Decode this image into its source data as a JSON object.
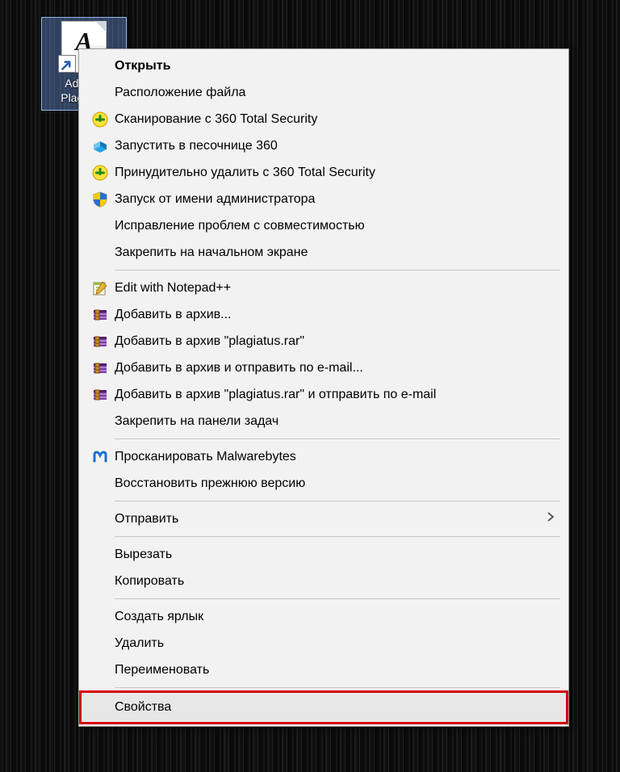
{
  "desktop": {
    "shortcut": {
      "label_line1": "Advego",
      "label_line2": "Plagiatus",
      "glyph": "A"
    }
  },
  "menu": {
    "items": [
      {
        "id": "open",
        "label": "Открыть",
        "icon": null,
        "bold": true
      },
      {
        "id": "file-location",
        "label": "Расположение файла",
        "icon": null
      },
      {
        "id": "scan-360",
        "label": "Сканирование с 360 Total Security",
        "icon": "scan360"
      },
      {
        "id": "sandbox-360",
        "label": "Запустить в песочнице 360",
        "icon": "sandbox"
      },
      {
        "id": "force-delete-360",
        "label": "Принудительно удалить с  360 Total Security",
        "icon": "scan360"
      },
      {
        "id": "run-as-admin",
        "label": "Запуск от имени администратора",
        "icon": "shield"
      },
      {
        "id": "compat-fix",
        "label": "Исправление проблем с совместимостью",
        "icon": null
      },
      {
        "id": "pin-start",
        "label": "Закрепить на начальном экране",
        "icon": null
      },
      {
        "sep": true
      },
      {
        "id": "edit-npp",
        "label": "Edit with Notepad++",
        "icon": "notepadpp"
      },
      {
        "id": "rar-add",
        "label": "Добавить в архив...",
        "icon": "winrar"
      },
      {
        "id": "rar-add-named",
        "label": "Добавить в архив \"plagiatus.rar\"",
        "icon": "winrar"
      },
      {
        "id": "rar-add-email",
        "label": "Добавить в архив и отправить по e-mail...",
        "icon": "winrar"
      },
      {
        "id": "rar-add-named-email",
        "label": "Добавить в архив \"plagiatus.rar\" и отправить по e-mail",
        "icon": "winrar"
      },
      {
        "id": "pin-taskbar",
        "label": "Закрепить на панели задач",
        "icon": null
      },
      {
        "sep": true
      },
      {
        "id": "scan-mwb",
        "label": "Просканировать Malwarebytes",
        "icon": "malwarebytes"
      },
      {
        "id": "restore-prev",
        "label": "Восстановить прежнюю версию",
        "icon": null
      },
      {
        "sep": true
      },
      {
        "id": "send-to",
        "label": "Отправить",
        "icon": null,
        "submenu": true
      },
      {
        "sep": true
      },
      {
        "id": "cut",
        "label": "Вырезать",
        "icon": null
      },
      {
        "id": "copy",
        "label": "Копировать",
        "icon": null
      },
      {
        "sep": true
      },
      {
        "id": "create-shortcut",
        "label": "Создать ярлык",
        "icon": null
      },
      {
        "id": "delete",
        "label": "Удалить",
        "icon": null
      },
      {
        "id": "rename",
        "label": "Переименовать",
        "icon": null
      },
      {
        "sep": true
      },
      {
        "id": "properties",
        "label": "Свойства",
        "icon": null,
        "highlighted": true
      }
    ]
  }
}
